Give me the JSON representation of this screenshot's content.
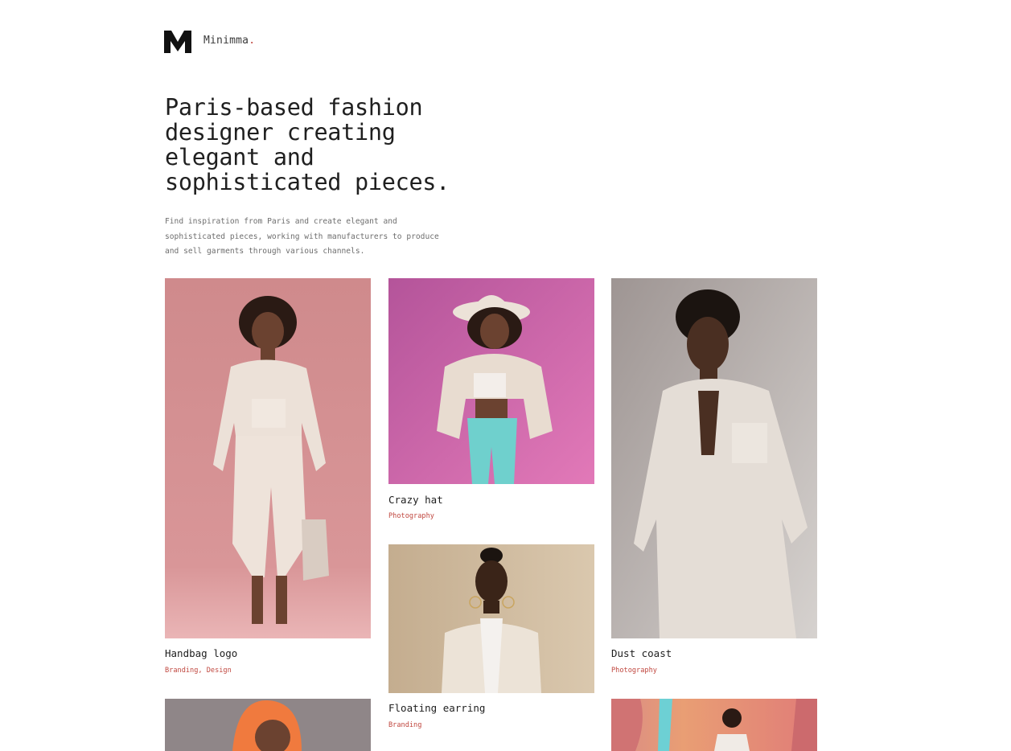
{
  "header": {
    "logo_icon": "m-logo-icon",
    "brand_name": "Minimma",
    "brand_dot": ".",
    "accent_color": "#c0473f"
  },
  "hero": {
    "title": "Paris-based fashion designer creating elegant and sophisticated pieces.",
    "description": "Find inspiration from Paris and create elegant and sophisticated pieces, working with manufacturers to produce and sell garments through various channels."
  },
  "portfolio": {
    "items": [
      {
        "title": "Handbag logo",
        "tags": "Branding, Design",
        "image": "woman-white-jacket-pink-background"
      },
      {
        "title": "Crazy hat",
        "tags": "Photography",
        "image": "woman-white-hat-magenta-background"
      },
      {
        "title": "Dust coast",
        "tags": "Photography",
        "image": "man-white-coat-grey-background"
      },
      {
        "title": "Floating earring",
        "tags": "Branding",
        "image": "woman-hoop-earrings-beige-background"
      },
      {
        "title": "",
        "tags": "",
        "image": "woman-orange-hair-grey-background"
      },
      {
        "title": "",
        "tags": "",
        "image": "woman-pastel-interior-background"
      }
    ]
  }
}
